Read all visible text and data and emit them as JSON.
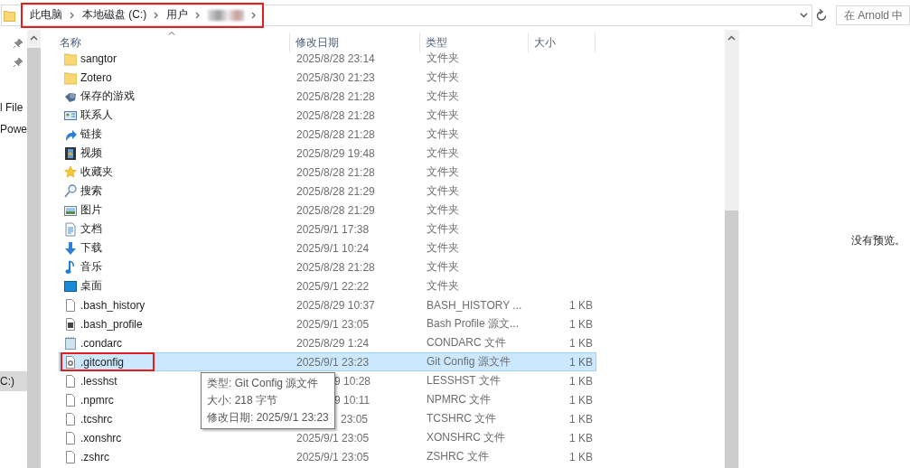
{
  "address_bar": {
    "annotated": true,
    "breadcrumb": [
      "此电脑",
      "本地磁盘 (C:)",
      "用户"
    ],
    "redacted": true
  },
  "search": {
    "placeholder": "在 Arnold 中"
  },
  "nav": {
    "items": [
      {
        "label": "l File",
        "selected": false
      },
      {
        "label": "Powe",
        "selected": false
      },
      {
        "label": "C:)",
        "selected": true
      }
    ]
  },
  "table": {
    "columns": [
      "名称",
      "修改日期",
      "类型",
      "大小"
    ],
    "rows": [
      {
        "kind": "folder",
        "name": "sangtor",
        "date": "2025/8/28 23:14",
        "type": "文件夹",
        "selected": false,
        "annotated": false
      },
      {
        "kind": "folder",
        "name": "Zotero",
        "date": "2025/8/30 21:23",
        "type": "文件夹",
        "selected": false,
        "annotated": false
      },
      {
        "kind": "games",
        "name": "保存的游戏",
        "date": "2025/8/28 21:28",
        "type": "文件夹",
        "selected": false,
        "annotated": false
      },
      {
        "kind": "contacts",
        "name": "联系人",
        "date": "2025/8/28 21:28",
        "type": "文件夹",
        "selected": false,
        "annotated": false
      },
      {
        "kind": "links",
        "name": "链接",
        "date": "2025/8/28 21:28",
        "type": "文件夹",
        "selected": false,
        "annotated": false
      },
      {
        "kind": "videos",
        "name": "视频",
        "date": "2025/8/29 19:48",
        "type": "文件夹",
        "selected": false,
        "annotated": false
      },
      {
        "kind": "favorites",
        "name": "收藏夹",
        "date": "2025/8/28 21:28",
        "type": "文件夹",
        "selected": false,
        "annotated": false
      },
      {
        "kind": "searches",
        "name": "搜索",
        "date": "2025/8/28 21:29",
        "type": "文件夹",
        "selected": false,
        "annotated": false
      },
      {
        "kind": "pictures",
        "name": "图片",
        "date": "2025/8/28 21:29",
        "type": "文件夹",
        "selected": false,
        "annotated": false
      },
      {
        "kind": "documents",
        "name": "文档",
        "date": "2025/9/1 17:38",
        "type": "文件夹",
        "selected": false,
        "annotated": false
      },
      {
        "kind": "downloads",
        "name": "下载",
        "date": "2025/9/1 10:24",
        "type": "文件夹",
        "selected": false,
        "annotated": false
      },
      {
        "kind": "music",
        "name": "音乐",
        "date": "2025/8/28 21:28",
        "type": "文件夹",
        "selected": false,
        "annotated": false
      },
      {
        "kind": "desktop",
        "name": "桌面",
        "date": "2025/9/1 22:22",
        "type": "文件夹",
        "selected": false,
        "annotated": false
      },
      {
        "kind": "file",
        "name": ".bash_history",
        "date": "2025/8/29 10:37",
        "type": "BASH_HISTORY ...",
        "size": "1 KB",
        "selected": false,
        "annotated": false
      },
      {
        "kind": "script",
        "name": ".bash_profile",
        "date": "2025/9/1 23:05",
        "type": "Bash Profile 源文...",
        "size": "1 KB",
        "selected": false,
        "annotated": false
      },
      {
        "kind": "notes",
        "name": ".condarc",
        "date": "2025/8/29 1:24",
        "type": "CONDARC 文件",
        "size": "1 KB",
        "selected": false,
        "annotated": false
      },
      {
        "kind": "config",
        "name": ".gitconfig",
        "date": "2025/9/1 23:23",
        "type": "Git Config 源文件",
        "size": "1 KB",
        "selected": true,
        "annotated": true
      },
      {
        "kind": "file",
        "name": ".lesshst",
        "date": "9 10:28",
        "type": "LESSHST 文件",
        "size": "1 KB",
        "selected": false,
        "annotated": false
      },
      {
        "kind": "file",
        "name": ".npmrc",
        "date": "9 10:11",
        "type": "NPMRC 文件",
        "size": "1 KB",
        "selected": false,
        "annotated": false
      },
      {
        "kind": "file",
        "name": ".tcshrc",
        "date": "23:05",
        "type": "TCSHRC 文件",
        "size": "1 KB",
        "selected": false,
        "annotated": false
      },
      {
        "kind": "file",
        "name": ".xonshrc",
        "date": "2025/9/1 23:05",
        "type": "XONSHRC 文件",
        "size": "1 KB",
        "selected": false,
        "annotated": false
      },
      {
        "kind": "file",
        "name": ".zshrc",
        "date": "2025/9/1 23:05",
        "type": "ZSHRC 文件",
        "size": "1 KB",
        "selected": false,
        "annotated": false
      }
    ]
  },
  "tooltip": {
    "lines": [
      "类型: Git Config 源文件",
      "大小: 218 字节",
      "修改日期: 2025/9/1 23:23"
    ]
  },
  "preview": {
    "message": "没有预览。"
  }
}
